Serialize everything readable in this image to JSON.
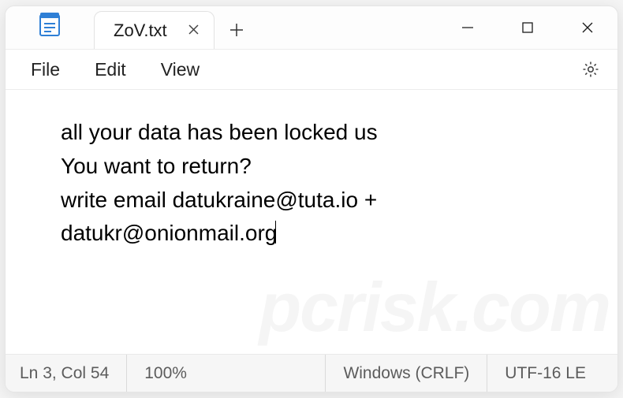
{
  "tab": {
    "title": "ZoV.txt"
  },
  "menu": {
    "file": "File",
    "edit": "Edit",
    "view": "View"
  },
  "content": {
    "line1": "all your data has been locked us",
    "line2": "You want to return?",
    "line3": "write email datukraine@tuta.io + ",
    "line4": "datukr@onionmail.org"
  },
  "status": {
    "position": "Ln 3, Col 54",
    "zoom": "100%",
    "lineending": "Windows (CRLF)",
    "encoding": "UTF-16 LE"
  },
  "watermark": "pcrisk.com"
}
